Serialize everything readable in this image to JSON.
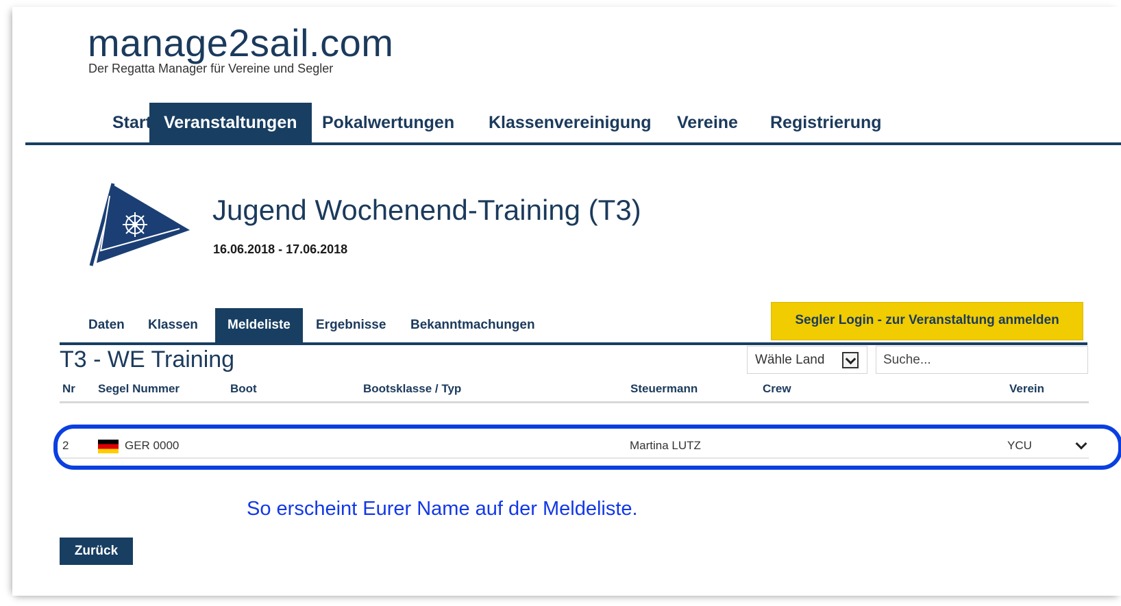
{
  "site": {
    "title": "manage2sail.com",
    "tagline": "Der Regatta Manager für Vereine und Segler"
  },
  "main_nav": {
    "items": [
      {
        "label": "Start",
        "active": false
      },
      {
        "label": "Veranstaltungen",
        "active": true
      },
      {
        "label": "Pokalwertungen",
        "active": false
      },
      {
        "label": "Klassenvereinigung",
        "active": false
      },
      {
        "label": "Vereine",
        "active": false
      },
      {
        "label": "Registrierung",
        "active": false
      }
    ]
  },
  "event": {
    "title": "Jugend Wochenend-Training (T3)",
    "dates": "16.06.2018 - 17.06.2018",
    "logo_icon": "club-burgee-flag-icon"
  },
  "sub_tabs": {
    "items": [
      {
        "label": "Daten",
        "active": false
      },
      {
        "label": "Klassen",
        "active": false
      },
      {
        "label": "Meldeliste",
        "active": true
      },
      {
        "label": "Ergebnisse",
        "active": false
      },
      {
        "label": "Bekanntmachungen",
        "active": false
      }
    ],
    "login_button": "Segler Login - zur Veranstaltung anmelden"
  },
  "entry_list": {
    "title": "T3 - WE Training",
    "country_select": {
      "selected": "Wähle Land",
      "icon": "dropdown-arrow-icon"
    },
    "search": {
      "placeholder": "Suche...",
      "value": ""
    },
    "columns": [
      "Nr",
      "Segel Nummer",
      "Boot",
      "Bootsklasse / Typ",
      "Steuermann",
      "Crew",
      "Verein"
    ],
    "rows": [
      {
        "nr": "2",
        "flag": "germany-flag-icon",
        "sail_number": "GER 0000",
        "boat": "",
        "class_type": "",
        "helmsman": "Martina LUTZ",
        "crew": "",
        "club": "YCU",
        "expand_icon": "chevron-down-icon"
      }
    ]
  },
  "annotation": "So erscheint Eurer Name auf der Meldeliste.",
  "back_button": "Zurück",
  "colors": {
    "navy": "#183e62",
    "title_blue": "#1b3a5c",
    "login_yellow": "#f0cc00",
    "highlight_blue": "#0a3fe0",
    "annotation_blue": "#1238e6"
  }
}
